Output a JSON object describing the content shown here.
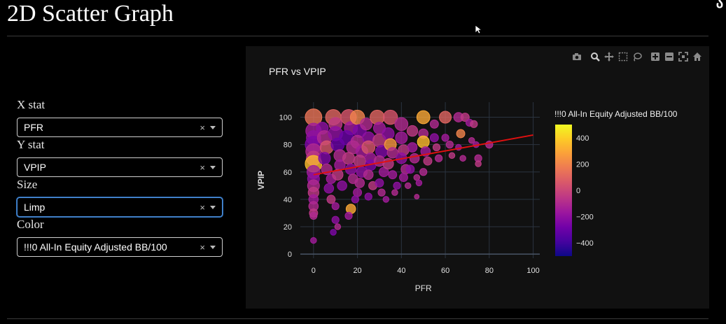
{
  "page": {
    "title": "2D Scatter Graph",
    "corner_text": "ა"
  },
  "controls": [
    {
      "label": "X stat",
      "value": "PFR",
      "clear": "×"
    },
    {
      "label": "Y stat",
      "value": "VPIP",
      "clear": "×"
    },
    {
      "label": "Size",
      "value": "Limp",
      "clear": "×"
    },
    {
      "label": "Color",
      "value": "!!!0 All-In Equity Adjusted BB/100",
      "clear": "×"
    }
  ],
  "modebar": [
    "camera-icon",
    "zoom-icon",
    "pan-icon",
    "box-select-icon",
    "lasso-icon",
    "zoom-in-icon",
    "zoom-out-icon",
    "autoscale-icon",
    "reset-axes-icon"
  ],
  "chart_data": {
    "type": "scatter",
    "title": "PFR vs VPIP",
    "xlabel": "PFR",
    "ylabel": "VPIP",
    "xlim": [
      -6,
      103
    ],
    "ylim": [
      -3,
      111
    ],
    "x_ticks": [
      0,
      20,
      40,
      60,
      80,
      100
    ],
    "y_ticks": [
      0,
      20,
      40,
      60,
      80,
      100
    ],
    "grid": true,
    "colorbar": {
      "title": "!!!0 All-In Equity Adjusted BB/100",
      "min": -500,
      "max": 500,
      "ticks": [
        400,
        200,
        0,
        -200,
        -400
      ],
      "tick_labels": [
        "400",
        "200",
        "0",
        "−200",
        "−400"
      ],
      "colors": [
        "#f0f921",
        "#fdca26",
        "#fb9f3a",
        "#ed7953",
        "#d8576b",
        "#bd3786",
        "#9c179e",
        "#7201a8",
        "#46039f",
        "#0d0887"
      ]
    },
    "trendline": {
      "x": [
        0,
        100
      ],
      "y": [
        58,
        87
      ],
      "color": "#e01010"
    },
    "points": [
      {
        "x": 0,
        "y": 100,
        "c": 150,
        "s": 14
      },
      {
        "x": 0,
        "y": 90,
        "c": -150,
        "s": 13
      },
      {
        "x": 0,
        "y": 85,
        "c": -200,
        "s": 12
      },
      {
        "x": 0,
        "y": 80,
        "c": -250,
        "s": 14
      },
      {
        "x": 0,
        "y": 75,
        "c": -100,
        "s": 13
      },
      {
        "x": 0,
        "y": 70,
        "c": -50,
        "s": 12
      },
      {
        "x": 0,
        "y": 66,
        "c": 350,
        "s": 14
      },
      {
        "x": 0,
        "y": 60,
        "c": -150,
        "s": 11
      },
      {
        "x": 0,
        "y": 55,
        "c": -200,
        "s": 10
      },
      {
        "x": 0,
        "y": 50,
        "c": -100,
        "s": 10
      },
      {
        "x": 0,
        "y": 45,
        "c": -50,
        "s": 9
      },
      {
        "x": 0,
        "y": 40,
        "c": -150,
        "s": 8
      },
      {
        "x": 0,
        "y": 35,
        "c": -100,
        "s": 8
      },
      {
        "x": 0,
        "y": 30,
        "c": -50,
        "s": 7
      },
      {
        "x": 0,
        "y": 28,
        "c": -100,
        "s": 6
      },
      {
        "x": 0,
        "y": 10,
        "c": -150,
        "s": 5
      },
      {
        "x": 4,
        "y": 92,
        "c": -200,
        "s": 10
      },
      {
        "x": 5,
        "y": 85,
        "c": -100,
        "s": 12
      },
      {
        "x": 6,
        "y": 78,
        "c": 50,
        "s": 11
      },
      {
        "x": 5,
        "y": 70,
        "c": -250,
        "s": 10
      },
      {
        "x": 6,
        "y": 62,
        "c": -100,
        "s": 9
      },
      {
        "x": 8,
        "y": 55,
        "c": -150,
        "s": 8
      },
      {
        "x": 7,
        "y": 48,
        "c": -200,
        "s": 8
      },
      {
        "x": 8,
        "y": 40,
        "c": -50,
        "s": 7
      },
      {
        "x": 9,
        "y": 100,
        "c": 100,
        "s": 13
      },
      {
        "x": 10,
        "y": 95,
        "c": -50,
        "s": 11
      },
      {
        "x": 10,
        "y": 88,
        "c": -200,
        "s": 12
      },
      {
        "x": 11,
        "y": 80,
        "c": -300,
        "s": 11
      },
      {
        "x": 12,
        "y": 72,
        "c": -100,
        "s": 10
      },
      {
        "x": 12,
        "y": 65,
        "c": -150,
        "s": 9
      },
      {
        "x": 11,
        "y": 58,
        "c": -50,
        "s": 9
      },
      {
        "x": 13,
        "y": 50,
        "c": -200,
        "s": 8
      },
      {
        "x": 10,
        "y": 35,
        "c": -150,
        "s": 6
      },
      {
        "x": 10,
        "y": 25,
        "c": -200,
        "s": 6
      },
      {
        "x": 11,
        "y": 20,
        "c": -100,
        "s": 5
      },
      {
        "x": 9,
        "y": 16,
        "c": -250,
        "s": 5
      },
      {
        "x": 16,
        "y": 100,
        "c": 50,
        "s": 13
      },
      {
        "x": 17,
        "y": 92,
        "c": -150,
        "s": 11
      },
      {
        "x": 15,
        "y": 85,
        "c": -300,
        "s": 12
      },
      {
        "x": 18,
        "y": 78,
        "c": -100,
        "s": 11
      },
      {
        "x": 16,
        "y": 70,
        "c": -50,
        "s": 10
      },
      {
        "x": 17,
        "y": 62,
        "c": -200,
        "s": 9
      },
      {
        "x": 18,
        "y": 55,
        "c": -100,
        "s": 8
      },
      {
        "x": 17,
        "y": 33,
        "c": 300,
        "s": 8
      },
      {
        "x": 16,
        "y": 28,
        "c": -150,
        "s": 6
      },
      {
        "x": 20,
        "y": 100,
        "c": 200,
        "s": 12
      },
      {
        "x": 21,
        "y": 90,
        "c": -250,
        "s": 11
      },
      {
        "x": 20,
        "y": 82,
        "c": -100,
        "s": 11
      },
      {
        "x": 22,
        "y": 75,
        "c": -150,
        "s": 10
      },
      {
        "x": 21,
        "y": 68,
        "c": -50,
        "s": 10
      },
      {
        "x": 22,
        "y": 60,
        "c": -200,
        "s": 9
      },
      {
        "x": 21,
        "y": 52,
        "c": -100,
        "s": 8
      },
      {
        "x": 20,
        "y": 45,
        "c": -150,
        "s": 7
      },
      {
        "x": 19,
        "y": 40,
        "c": -200,
        "s": 6
      },
      {
        "x": 24,
        "y": 95,
        "c": -100,
        "s": 10
      },
      {
        "x": 25,
        "y": 85,
        "c": -200,
        "s": 10
      },
      {
        "x": 25,
        "y": 78,
        "c": 50,
        "s": 11
      },
      {
        "x": 26,
        "y": 70,
        "c": -150,
        "s": 9
      },
      {
        "x": 26,
        "y": 65,
        "c": -250,
        "s": 9
      },
      {
        "x": 25,
        "y": 58,
        "c": -100,
        "s": 8
      },
      {
        "x": 27,
        "y": 50,
        "c": -50,
        "s": 7
      },
      {
        "x": 25,
        "y": 42,
        "c": -200,
        "s": 6
      },
      {
        "x": 29,
        "y": 100,
        "c": 100,
        "s": 12
      },
      {
        "x": 30,
        "y": 92,
        "c": -150,
        "s": 10
      },
      {
        "x": 30,
        "y": 83,
        "c": -50,
        "s": 11
      },
      {
        "x": 31,
        "y": 75,
        "c": -250,
        "s": 10
      },
      {
        "x": 30,
        "y": 68,
        "c": -100,
        "s": 9
      },
      {
        "x": 32,
        "y": 60,
        "c": -150,
        "s": 8
      },
      {
        "x": 30,
        "y": 52,
        "c": -200,
        "s": 7
      },
      {
        "x": 31,
        "y": 45,
        "c": -100,
        "s": 6
      },
      {
        "x": 33,
        "y": 40,
        "c": -150,
        "s": 5
      },
      {
        "x": 35,
        "y": 100,
        "c": 50,
        "s": 12
      },
      {
        "x": 34,
        "y": 88,
        "c": -200,
        "s": 10
      },
      {
        "x": 35,
        "y": 80,
        "c": 250,
        "s": 10
      },
      {
        "x": 36,
        "y": 74,
        "c": -100,
        "s": 9
      },
      {
        "x": 34,
        "y": 66,
        "c": -50,
        "s": 9
      },
      {
        "x": 36,
        "y": 58,
        "c": -150,
        "s": 7
      },
      {
        "x": 38,
        "y": 50,
        "c": -200,
        "s": 6
      },
      {
        "x": 37,
        "y": 45,
        "c": -100,
        "s": 5
      },
      {
        "x": 40,
        "y": 95,
        "c": -100,
        "s": 11
      },
      {
        "x": 40,
        "y": 85,
        "c": -150,
        "s": 10
      },
      {
        "x": 41,
        "y": 76,
        "c": -50,
        "s": 9
      },
      {
        "x": 40,
        "y": 70,
        "c": -200,
        "s": 9
      },
      {
        "x": 42,
        "y": 62,
        "c": -100,
        "s": 8
      },
      {
        "x": 41,
        "y": 56,
        "c": -150,
        "s": 7
      },
      {
        "x": 43,
        "y": 50,
        "c": -100,
        "s": 5
      },
      {
        "x": 45,
        "y": 90,
        "c": -50,
        "s": 9
      },
      {
        "x": 45,
        "y": 78,
        "c": -150,
        "s": 8
      },
      {
        "x": 46,
        "y": 70,
        "c": -100,
        "s": 8
      },
      {
        "x": 44,
        "y": 62,
        "c": -200,
        "s": 7
      },
      {
        "x": 47,
        "y": 56,
        "c": -100,
        "s": 5
      },
      {
        "x": 50,
        "y": 100,
        "c": 300,
        "s": 11
      },
      {
        "x": 50,
        "y": 88,
        "c": -100,
        "s": 8
      },
      {
        "x": 50,
        "y": 82,
        "c": 350,
        "s": 10
      },
      {
        "x": 51,
        "y": 75,
        "c": -150,
        "s": 8
      },
      {
        "x": 52,
        "y": 68,
        "c": -50,
        "s": 7
      },
      {
        "x": 50,
        "y": 60,
        "c": -100,
        "s": 6
      },
      {
        "x": 48,
        "y": 52,
        "c": -150,
        "s": 5
      },
      {
        "x": 47,
        "y": 42,
        "c": -100,
        "s": 4
      },
      {
        "x": 55,
        "y": 95,
        "c": -100,
        "s": 7
      },
      {
        "x": 55,
        "y": 85,
        "c": -200,
        "s": 7
      },
      {
        "x": 56,
        "y": 78,
        "c": -50,
        "s": 6
      },
      {
        "x": 57,
        "y": 70,
        "c": -100,
        "s": 6
      },
      {
        "x": 60,
        "y": 100,
        "c": 100,
        "s": 10
      },
      {
        "x": 60,
        "y": 85,
        "c": -150,
        "s": 6
      },
      {
        "x": 62,
        "y": 80,
        "c": -100,
        "s": 6
      },
      {
        "x": 63,
        "y": 72,
        "c": -50,
        "s": 5
      },
      {
        "x": 66,
        "y": 100,
        "c": -100,
        "s": 8
      },
      {
        "x": 67,
        "y": 88,
        "c": 200,
        "s": 7
      },
      {
        "x": 66,
        "y": 78,
        "c": -150,
        "s": 5
      },
      {
        "x": 68,
        "y": 70,
        "c": -100,
        "s": 5
      },
      {
        "x": 69,
        "y": 100,
        "c": -50,
        "s": 7
      },
      {
        "x": 71,
        "y": 96,
        "c": -150,
        "s": 6
      },
      {
        "x": 72,
        "y": 83,
        "c": -100,
        "s": 5
      },
      {
        "x": 73,
        "y": 95,
        "c": -50,
        "s": 6
      },
      {
        "x": 74,
        "y": 80,
        "c": -150,
        "s": 5
      },
      {
        "x": 75,
        "y": 70,
        "c": -100,
        "s": 6
      },
      {
        "x": 75,
        "y": 66,
        "c": -50,
        "s": 5
      },
      {
        "x": 80,
        "y": 80,
        "c": -100,
        "s": 6
      }
    ]
  }
}
